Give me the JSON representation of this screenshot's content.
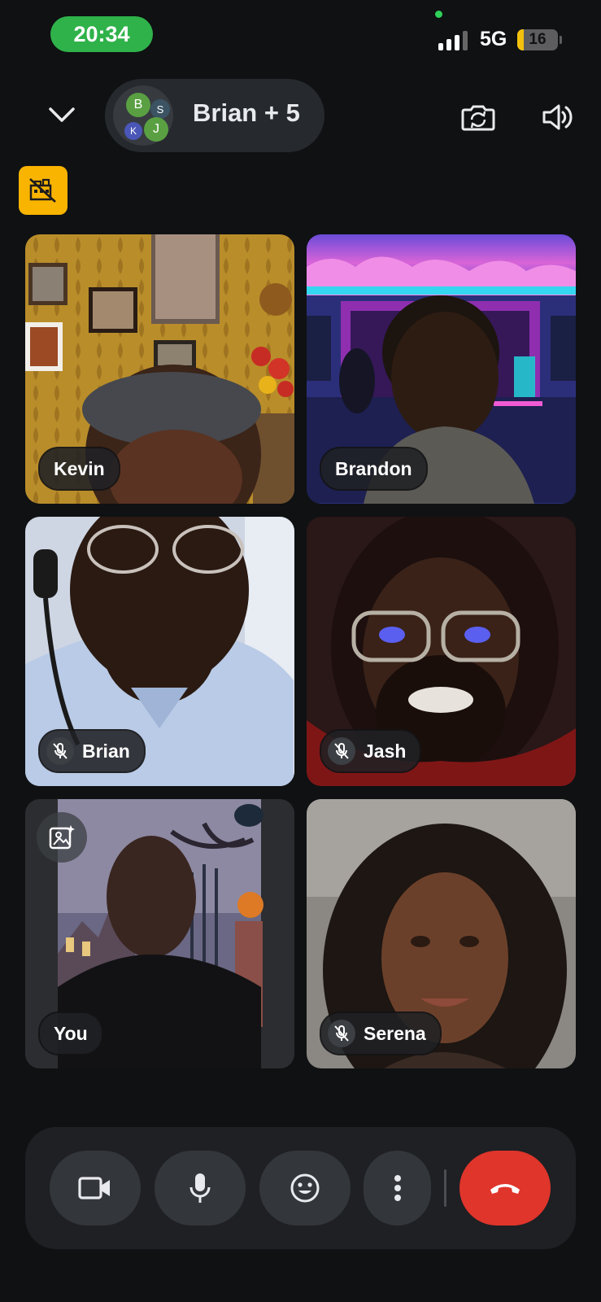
{
  "status_bar": {
    "time": "20:34",
    "network": "5G",
    "battery": "16",
    "battery_level": 0.16,
    "signal_bars": 3
  },
  "header": {
    "title": "Brian + 5",
    "avatars": [
      {
        "initial": "B",
        "color": "#5aa042"
      },
      {
        "initial": "S",
        "color": "#3b5363"
      },
      {
        "initial": "K",
        "color": "#4b57b7"
      },
      {
        "initial": "J",
        "color": "#5aa042"
      }
    ],
    "background_badge_color": "#f9b400"
  },
  "participants": [
    {
      "name": "Kevin",
      "muted": false
    },
    {
      "name": "Brandon",
      "muted": false
    },
    {
      "name": "Brian",
      "muted": true
    },
    {
      "name": "Jash",
      "muted": true
    },
    {
      "name": "You",
      "muted": false,
      "self": true
    },
    {
      "name": "Serena",
      "muted": true
    }
  ],
  "controls": {
    "buttons": [
      "camera-icon",
      "microphone-icon",
      "emoji-icon",
      "more-options-icon",
      "end-call-icon"
    ],
    "hangup_color": "#e0352b"
  }
}
